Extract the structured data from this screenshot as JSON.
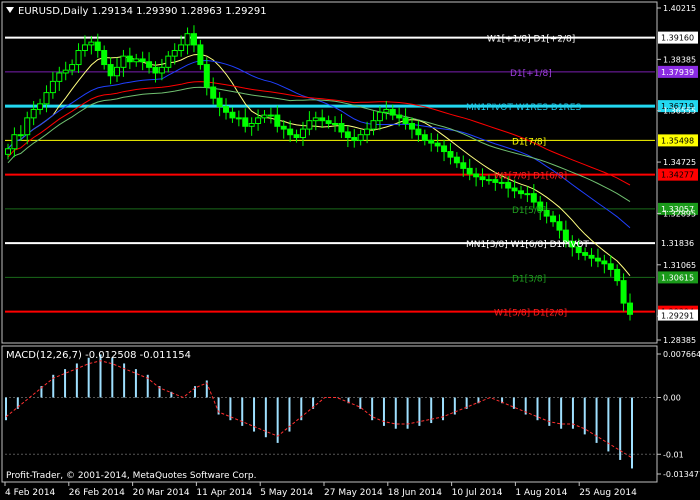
{
  "main": {
    "header": "EURUSD,Daily  1.29134 1.29390 1.28963 1.29291",
    "price_ticks": [
      "1.40215",
      "1.38385",
      "1.36555",
      "1.34725",
      "1.32895",
      "1.31065",
      "1.29235",
      "1.28385"
    ],
    "levels": [
      {
        "value": 1.3916,
        "label": "W1[+1/8] D1[+2/8]",
        "label_color": "#ffffff",
        "line_color": "#ffffff",
        "badge": "1.39160",
        "badge_bg": "#ffffff",
        "badge_fg": "#000000",
        "thick": 2
      },
      {
        "value": 1.37939,
        "label": "D1[+1/8]",
        "label_color": "#a040e0",
        "line_color": "#7a1fb0",
        "badge": "1.37939",
        "badge_bg": "#8a2be2",
        "badge_fg": "#ffffff",
        "thick": 1
      },
      {
        "value": 1.36719,
        "label": "MN1PIVOT W1RES D1RES",
        "label_color": "#22c8e8",
        "line_color": "#22d8f0",
        "badge": "1.36719",
        "badge_bg": "#22d8f0",
        "badge_fg": "#000000",
        "thick": 3
      },
      {
        "value": 1.35498,
        "label": "D1[7/8]",
        "label_color": "#ffff00",
        "line_color": "#ffff00",
        "badge": "1.35498",
        "badge_bg": "#ffff00",
        "badge_fg": "#000000",
        "thick": 1
      },
      {
        "value": 1.34277,
        "label": "W1[7/8] D1[6/8]",
        "label_color": "#ff2020",
        "line_color": "#ff0000",
        "badge": "1.34277",
        "badge_bg": "#ff0000",
        "badge_fg": "#000000",
        "thick": 2
      },
      {
        "value": 1.33057,
        "label": "D1[5/8]",
        "label_color": "#20a020",
        "line_color": "#1a6a1a",
        "badge": "1.33057",
        "badge_bg": "#1a9a1a",
        "badge_fg": "#ffffff",
        "thick": 1
      },
      {
        "value": 1.31836,
        "label": "MN1[3/8] W1[6/8] D1PIVOT",
        "label_color": "#ffffff",
        "line_color": "#ffffff",
        "badge": "1.31836",
        "badge_bg": "#000000",
        "badge_fg": "#ffffff",
        "thick": 2
      },
      {
        "value": 1.30615,
        "label": "D1[3/8]",
        "label_color": "#20a020",
        "line_color": "#1a6a1a",
        "badge": "1.30615",
        "badge_bg": "#1a9a1a",
        "badge_fg": "#ffffff",
        "thick": 1
      },
      {
        "value": 1.29394,
        "label": "W1[5/8] D1[2/8]",
        "label_color": "#ff2020",
        "line_color": "#ff0000",
        "badge": "1.29394",
        "badge_bg": "#ff0000",
        "badge_fg": "#000000",
        "thick": 2
      }
    ],
    "current_price_badge": "1.29291"
  },
  "macd": {
    "header": "MACD(12,26,7)  -0.012508  -0.011154",
    "ticks": [
      "0.007664",
      "0.00",
      "-0.01",
      "-0.013477"
    ]
  },
  "x_ticks": [
    "4 Feb 2014",
    "26 Feb 2014",
    "20 Mar 2014",
    "11 Apr 2014",
    "5 May 2014",
    "27 May 2014",
    "18 Jun 2014",
    "10 Jul 2014",
    "1 Aug 2014",
    "25 Aug 2014"
  ],
  "copyright": "Profit-Trader, © 2001-2014, MetaQuotes Software Corp.",
  "colors": {
    "bg": "#000000",
    "fg": "#ffffff",
    "candle": "#00ff00",
    "ma_fast": "#ffff80",
    "ma_mid": "#2040ff",
    "ma_slow1": "#ff0000",
    "ma_slow2": "#70c070",
    "macd_hist": "#9fe0ff",
    "macd_signal": "#ff3030"
  },
  "chart_data": {
    "type": "line",
    "title": "EURUSD,Daily",
    "series": [
      {
        "name": "EURUSD Close",
        "values": [
          1.352,
          1.357,
          1.357,
          1.363,
          1.366,
          1.368,
          1.372,
          1.376,
          1.379,
          1.38,
          1.382,
          1.387,
          1.389,
          1.39,
          1.387,
          1.382,
          1.378,
          1.381,
          1.385,
          1.383,
          1.384,
          1.383,
          1.381,
          1.379,
          1.381,
          1.385,
          1.387,
          1.389,
          1.393,
          1.389,
          1.382,
          1.374,
          1.37,
          1.367,
          1.365,
          1.363,
          1.363,
          1.36,
          1.361,
          1.363,
          1.364,
          1.364,
          1.36,
          1.359,
          1.357,
          1.356,
          1.359,
          1.362,
          1.363,
          1.362,
          1.361,
          1.361,
          1.358,
          1.356,
          1.355,
          1.357,
          1.359,
          1.362,
          1.365,
          1.366,
          1.364,
          1.363,
          1.361,
          1.359,
          1.357,
          1.355,
          1.354,
          1.353,
          1.351,
          1.349,
          1.347,
          1.345,
          1.343,
          1.342,
          1.341,
          1.341,
          1.34,
          1.34,
          1.338,
          1.337,
          1.336,
          1.336,
          1.333,
          1.33,
          1.328,
          1.326,
          1.323,
          1.319,
          1.317,
          1.315,
          1.314,
          1.313,
          1.312,
          1.311,
          1.309,
          1.305,
          1.297,
          1.293
        ]
      },
      {
        "name": "MACD",
        "values": [
          -0.004,
          -0.002,
          0.0,
          0.002,
          0.004,
          0.005,
          0.006,
          0.007,
          0.0076,
          0.007,
          0.006,
          0.005,
          0.004,
          0.002,
          0.001,
          0.0,
          0.002,
          0.003,
          -0.003,
          -0.004,
          -0.005,
          -0.006,
          -0.007,
          -0.008,
          -0.006,
          -0.004,
          -0.002,
          0.0,
          0.0,
          -0.001,
          -0.002,
          -0.004,
          -0.005,
          -0.0055,
          -0.0055,
          -0.005,
          -0.0045,
          -0.004,
          -0.003,
          -0.002,
          -0.001,
          0.0,
          -0.001,
          -0.002,
          -0.003,
          -0.004,
          -0.005,
          -0.0055,
          -0.0055,
          -0.0065,
          -0.008,
          -0.0095,
          -0.011,
          -0.0125
        ]
      }
    ],
    "ylim": [
      1.28385,
      1.40215
    ]
  }
}
